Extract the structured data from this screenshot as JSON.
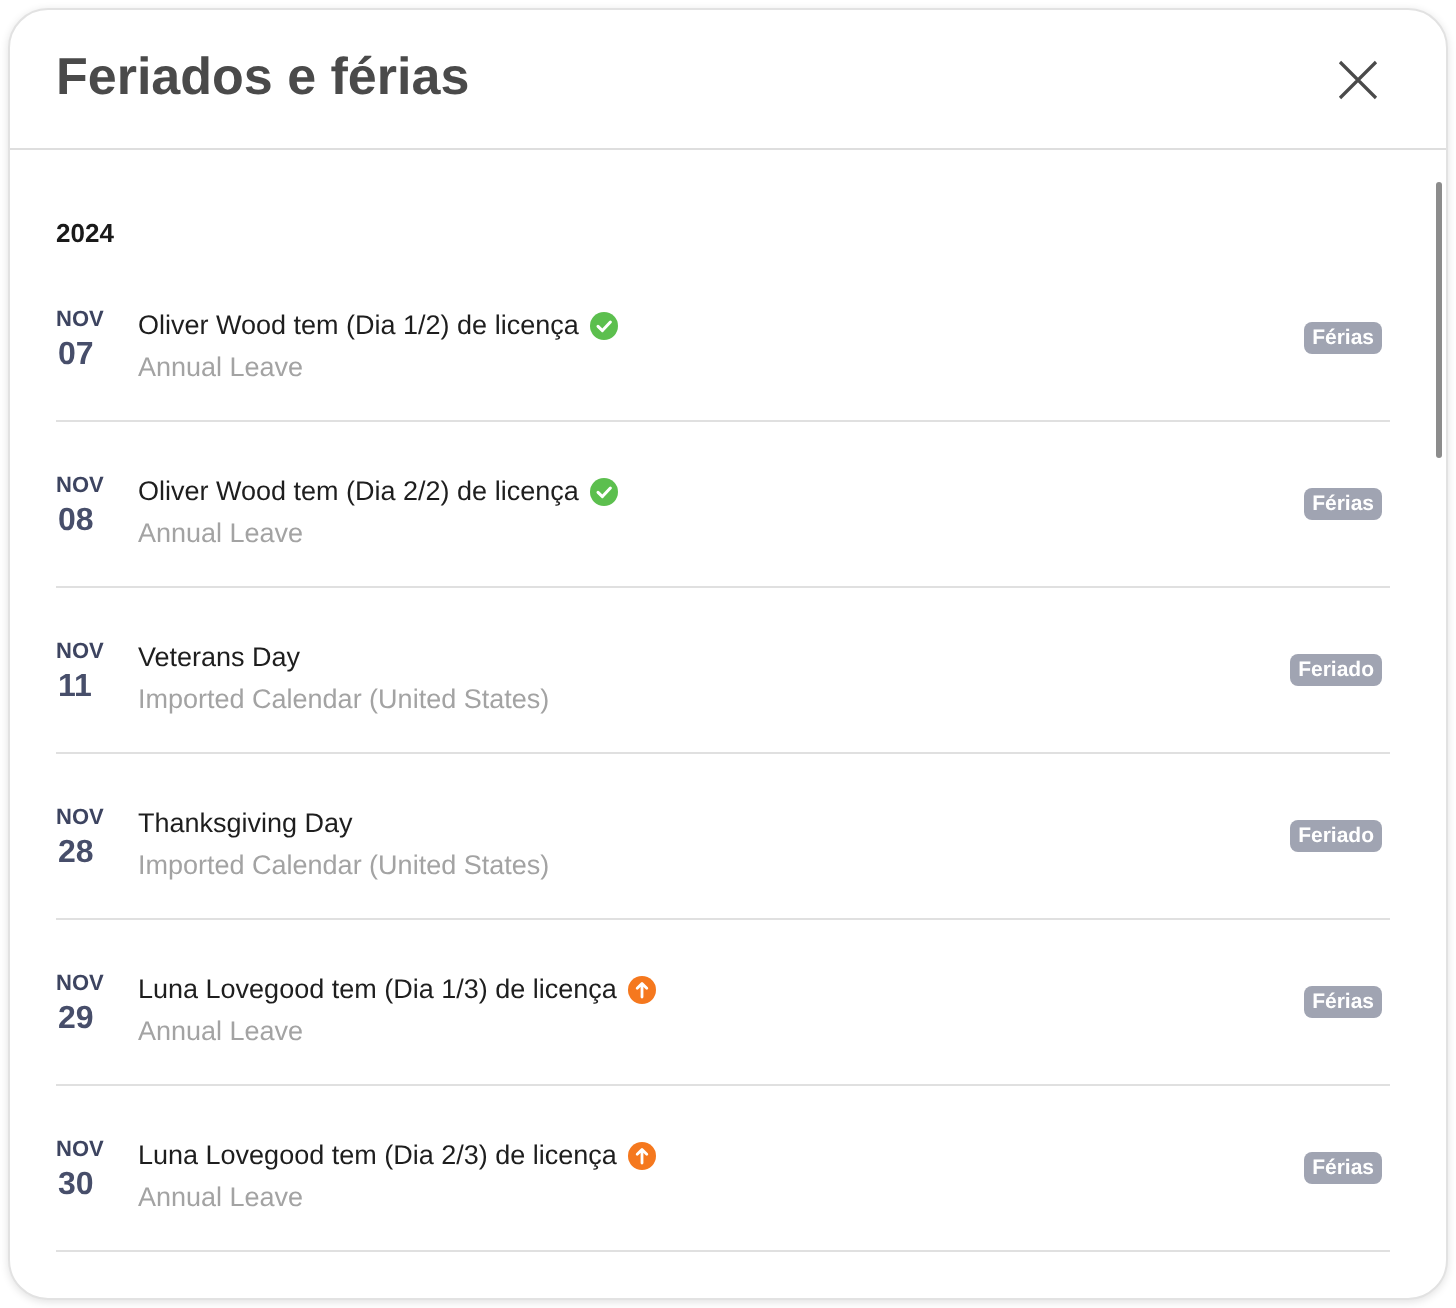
{
  "dialog": {
    "title": "Feriados e férias"
  },
  "year": "2024",
  "events": [
    {
      "kind": "approved",
      "month": "NOV",
      "day": "07",
      "title": "Oliver Wood tem (Dia 1/2) de licença",
      "subtitle": "Annual Leave",
      "tag": "Férias"
    },
    {
      "kind": "approved",
      "month": "NOV",
      "day": "08",
      "title": "Oliver Wood tem (Dia 2/2) de licença",
      "subtitle": "Annual Leave",
      "tag": "Férias"
    },
    {
      "kind": "holiday",
      "month": "NOV",
      "day": "11",
      "title": "Veterans Day",
      "subtitle": "Imported Calendar (United States)",
      "tag": "Feriado"
    },
    {
      "kind": "holiday",
      "month": "NOV",
      "day": "28",
      "title": "Thanksgiving Day",
      "subtitle": "Imported Calendar (United States)",
      "tag": "Feriado"
    },
    {
      "kind": "pending",
      "month": "NOV",
      "day": "29",
      "title": "Luna Lovegood tem (Dia 1/3) de licença",
      "subtitle": "Annual Leave",
      "tag": "Férias"
    },
    {
      "kind": "pending",
      "month": "NOV",
      "day": "30",
      "title": "Luna Lovegood tem (Dia 2/3) de licença",
      "subtitle": "Annual Leave",
      "tag": "Férias"
    }
  ]
}
